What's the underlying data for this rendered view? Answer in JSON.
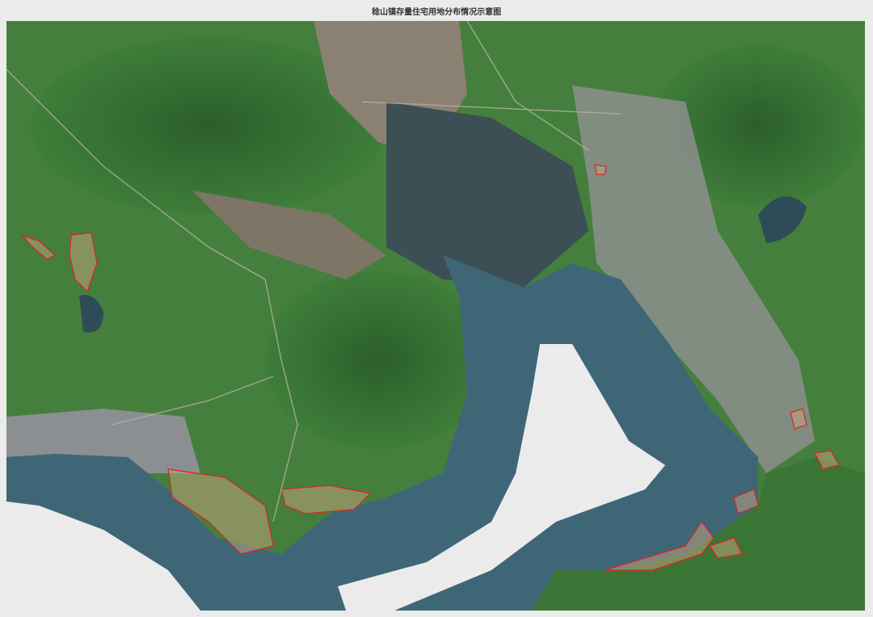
{
  "title": "稔山镇存量住宅用地分布情况示意图",
  "colors": {
    "land": "#3f7a3a",
    "forest": "#2f6a2e",
    "sea": "#3f6677",
    "urban": "#8a8d8c",
    "parcel": "#e02020",
    "background": "#ebebeb"
  }
}
